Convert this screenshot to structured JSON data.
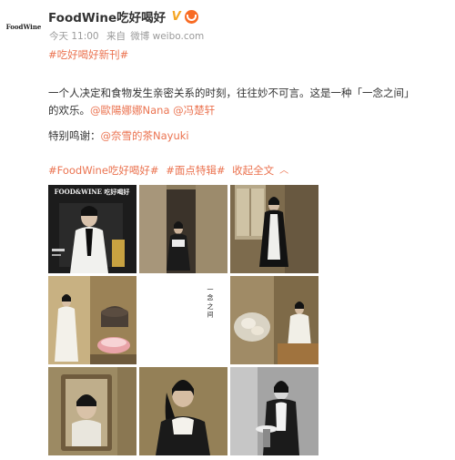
{
  "account": {
    "avatar_text": "FoodWine",
    "name": "FoodWine吃好喝好",
    "verified_mark": "V"
  },
  "meta": {
    "time": "今天 11:00",
    "source_prefix": "来自",
    "source": "微博 weibo.com"
  },
  "post": {
    "topic": "#吃好喝好新刊#",
    "body_line1": "一个人决定和食物发生亲密关系的时刻，往往妙不可言。这是一种「一念之间」",
    "body_line2_text": "的欢乐。",
    "mention1": "@歐陽娜娜Nana",
    "mention2": "@冯楚轩",
    "thanks_label": "特别鸣谢：",
    "thanks_mention": "@奈雪的茶Nayuki",
    "tag1": "#FoodWine吃好喝好#",
    "tag2": "#面点特辑#",
    "collapse_label": "收起全文",
    "collapse_icon": "chevron-up-icon"
  },
  "photos": [
    {
      "name": "magazine-cover-photo",
      "cover_title": "FOOD&WINE 吃好喝好"
    },
    {
      "name": "doorway-portrait-photo"
    },
    {
      "name": "window-standing-photo"
    },
    {
      "name": "cake-table-photo"
    },
    {
      "name": "title-text-photo",
      "vertical_text": "一 念 之 间"
    },
    {
      "name": "pastry-plate-photo"
    },
    {
      "name": "mirror-portrait-photo"
    },
    {
      "name": "seated-portrait-photo"
    },
    {
      "name": "bw-portrait-photo"
    }
  ]
}
